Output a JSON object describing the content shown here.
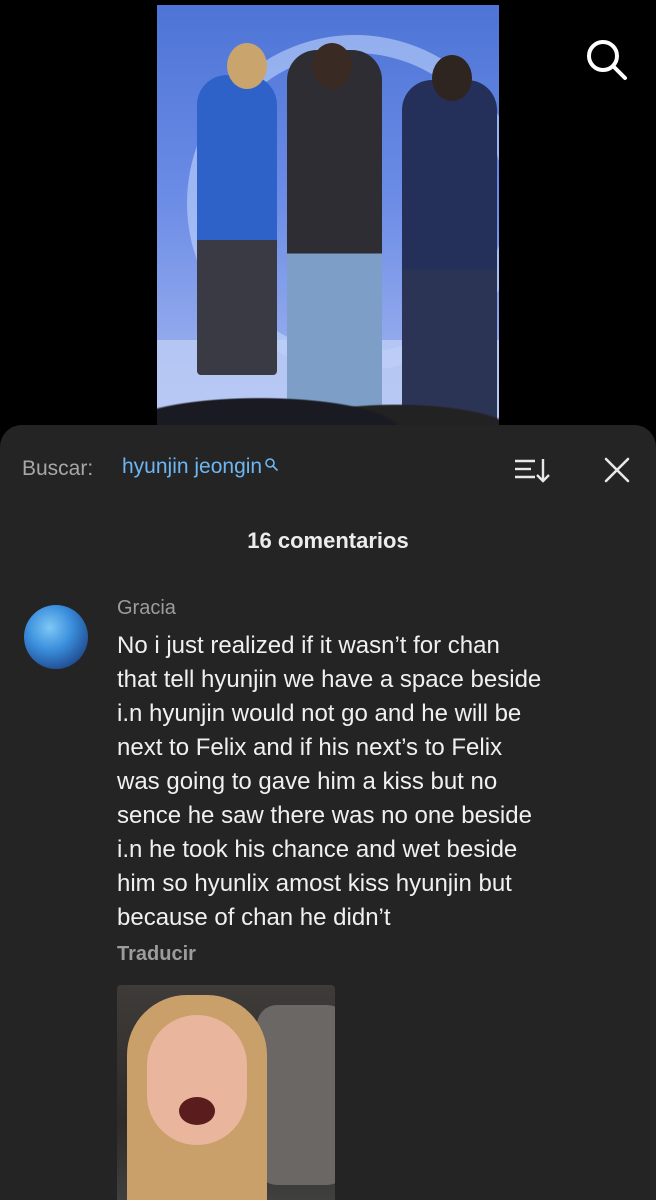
{
  "search": {
    "label": "Buscar:",
    "query": "hyunjin jeongin"
  },
  "comments_count": "16 comentarios",
  "comment": {
    "username": "Gracia",
    "text": "No i just realized if it wasn’t for chan\nthat tell hyunjin we have a space beside\ni.n hyunjin would not go and he will be\nnext to Felix and if his next’s to Felix\nwas going to gave him a kiss but no\nsence he saw there was no one beside\ni.n he took his chance and wet beside\nhim so hyunlix amost kiss hyunjin but\nbecause of chan he didn’t",
    "translate_label": "Traducir"
  },
  "icons": {
    "top_right": "search-icon",
    "sort": "sort-icon",
    "close": "close-icon"
  },
  "colors": {
    "accent": "#6db6f2",
    "panel": "#242424",
    "background": "#000000"
  }
}
